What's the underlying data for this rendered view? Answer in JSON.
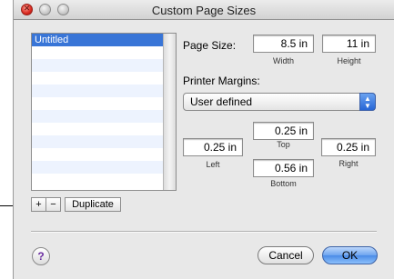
{
  "window": {
    "title": "Custom Page Sizes"
  },
  "sizes_list": {
    "items": [
      "Untitled",
      "",
      "",
      "",
      "",
      "",
      "",
      "",
      "",
      "",
      "",
      ""
    ],
    "selected_index": 0
  },
  "list_buttons": {
    "add": "+",
    "remove": "−",
    "duplicate": "Duplicate"
  },
  "page_size": {
    "label": "Page Size:",
    "width_value": "8.5 in",
    "width_label": "Width",
    "height_value": "11 in",
    "height_label": "Height"
  },
  "margins": {
    "label": "Printer Margins:",
    "preset_selected": "User defined",
    "top_value": "0.25 in",
    "top_label": "Top",
    "left_value": "0.25 in",
    "left_label": "Left",
    "right_value": "0.25 in",
    "right_label": "Right",
    "bottom_value": "0.56 in",
    "bottom_label": "Bottom"
  },
  "footer": {
    "help": "?",
    "cancel": "Cancel",
    "ok": "OK"
  },
  "colors": {
    "selection": "#3875d7",
    "default_button": "#6ea5ef",
    "stripe": "#edf3fe"
  }
}
